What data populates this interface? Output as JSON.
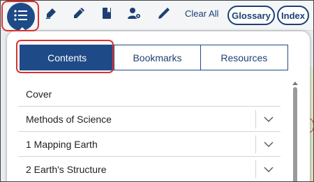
{
  "toolbar": {
    "icons": [
      "table-of-contents-icon",
      "highlighter-icon",
      "pencil-icon",
      "bookmark-icon",
      "settings-user-icon",
      "pen-icon"
    ],
    "clear_all_label": "Clear All",
    "glossary_label": "Glossary",
    "index_label": "Index"
  },
  "panel": {
    "tabs": [
      {
        "label": "Contents",
        "active": true
      },
      {
        "label": "Bookmarks",
        "active": false
      },
      {
        "label": "Resources",
        "active": false
      }
    ],
    "toc_items": [
      {
        "label": "Cover",
        "expandable": false
      },
      {
        "label": "Methods of Science",
        "expandable": true
      },
      {
        "label": "1 Mapping Earth",
        "expandable": true
      },
      {
        "label": "2 Earth's Structure",
        "expandable": true
      }
    ]
  },
  "colors": {
    "accent": "#1e4a87",
    "highlight": "#d9322f",
    "text": "#1d3f73"
  }
}
